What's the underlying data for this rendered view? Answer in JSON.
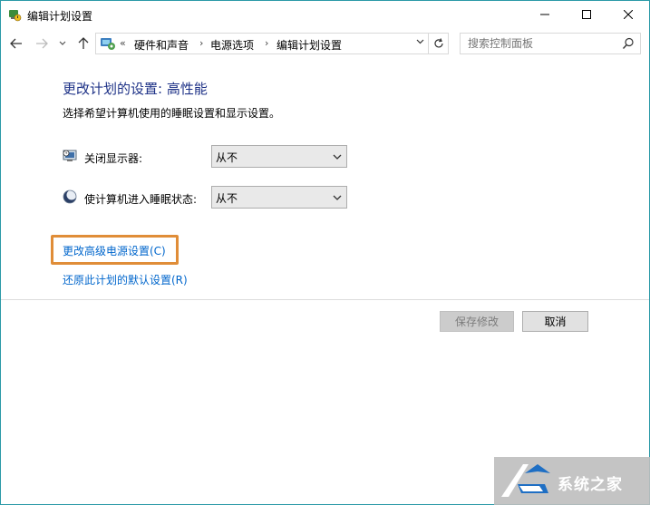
{
  "window": {
    "title": "编辑计划设置",
    "minimize": "—",
    "maximize": "☐",
    "close": "✕"
  },
  "nav": {
    "back": "←",
    "forward": "→",
    "recent": "⌄",
    "up": "↑",
    "breadcrumb_lead": "«",
    "breadcrumbs": [
      "硬件和声音",
      "电源选项",
      "编辑计划设置"
    ],
    "separator": "›",
    "dropdown": "⌄",
    "refresh": "↻",
    "search_placeholder": "搜索控制面板"
  },
  "main": {
    "heading": "更改计划的设置: 高性能",
    "subheading": "选择希望计算机使用的睡眠设置和显示设置。",
    "settings": [
      {
        "label": "关闭显示器:",
        "value": "从不",
        "icon": "display-icon"
      },
      {
        "label": "使计算机进入睡眠状态:",
        "value": "从不",
        "icon": "sleep-moon-icon"
      }
    ],
    "links": {
      "advanced": "更改高级电源设置(C)",
      "restore": "还原此计划的默认设置(R)"
    },
    "highlight_color": "#e08d38"
  },
  "buttons": {
    "save": "保存修改",
    "cancel": "取消"
  },
  "watermark": {
    "text": "系统之家"
  },
  "colors": {
    "window_border": "#2b9aa8",
    "heading": "#1e3287",
    "link": "#0066cc"
  }
}
